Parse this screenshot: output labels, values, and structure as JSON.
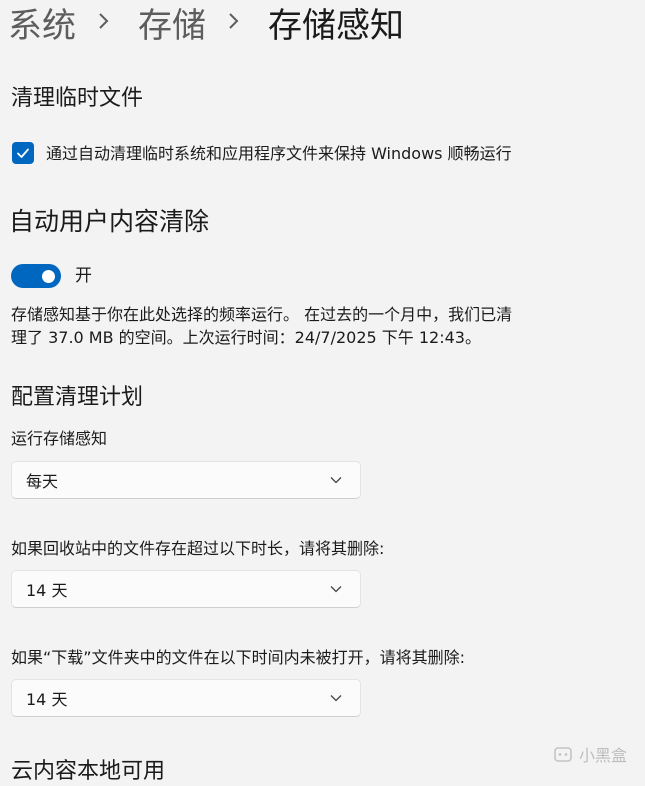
{
  "breadcrumb": {
    "items": [
      "系统",
      "存储"
    ],
    "current": "存储感知"
  },
  "cleanup_temp": {
    "title": "清理临时文件",
    "checkbox_label": "通过自动清理临时系统和应用程序文件来保持 Windows 顺畅运行",
    "checked": true
  },
  "auto_cleanup": {
    "title": "自动用户内容清除",
    "toggle_label": "开",
    "toggle_on": true,
    "description_line1": "存储感知基于你在此处选择的频率运行。 在过去的一个月中，我们已清",
    "description_line2": "理了 37.0 MB 的空间。上次运行时间：24/7/2025 下午 12:43。"
  },
  "schedule": {
    "title": "配置清理计划",
    "run_label": "运行存储感知",
    "run_value": "每天",
    "recycle_label": "如果回收站中的文件存在超过以下时长，请将其删除:",
    "recycle_value": "14 天",
    "downloads_label": "如果“下载”文件夹中的文件在以下时间内未被打开，请将其删除:",
    "downloads_value": "14 天"
  },
  "cloud": {
    "title": "云内容本地可用"
  },
  "watermark": {
    "text": "小黑盒"
  },
  "colors": {
    "accent": "#0067c0",
    "background": "#f3f3f3",
    "text": "#1b1b1b",
    "muted": "#5d5d5d"
  }
}
